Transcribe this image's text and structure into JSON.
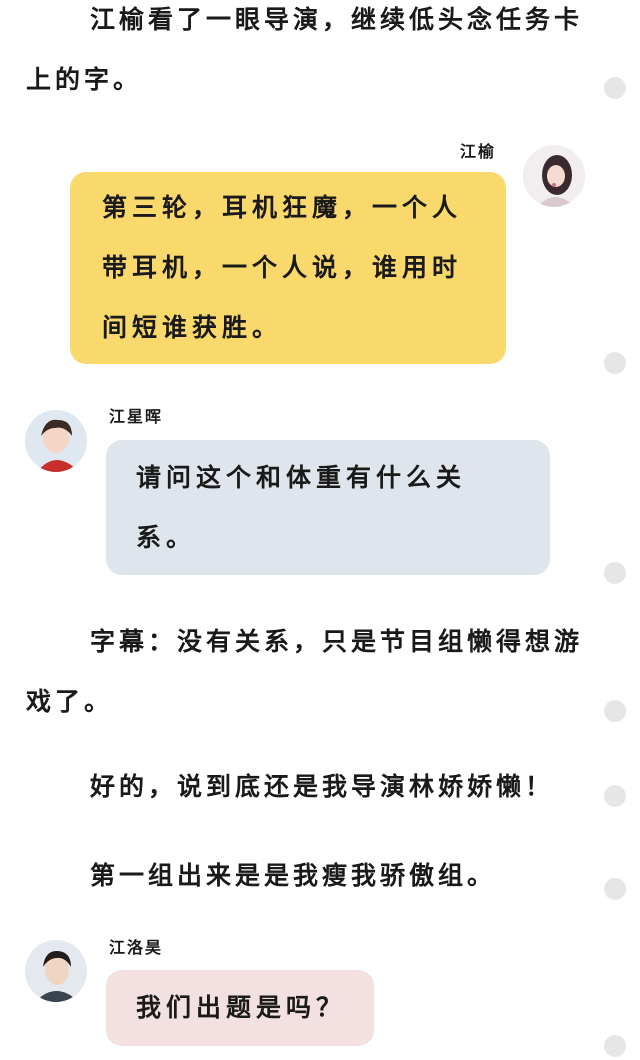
{
  "colors": {
    "bubble_yellow": "#FAD96C",
    "bubble_blue": "#DFE5EC",
    "bubble_pink": "#F3E0E0",
    "marker_gray": "#E6E6E6",
    "text": "#1A1A1A"
  },
  "paragraphs": [
    "江榆看了一眼导演，继续低头念任务卡上的字。",
    "字幕：没有关系，只是节目组懒得想游戏了。",
    "好的，说到底还是我导演林娇娇懒！",
    "第一组出来是是我瘦我骄傲组。"
  ],
  "messages": [
    {
      "sender": "江榆",
      "side": "right",
      "avatar_icon": "girl-portrait-icon",
      "lines": [
        "第三轮，耳机狂魔，一个人",
        "带耳机，一个人说，谁用时",
        "间短谁获胜。"
      ]
    },
    {
      "sender": "江星晖",
      "side": "left",
      "avatar_icon": "boy-portrait-icon",
      "lines": [
        "请问这个和体重有什么关",
        "系。"
      ]
    },
    {
      "sender": "江洛昊",
      "side": "left",
      "avatar_icon": "boy-portrait-icon",
      "lines": [
        "我们出题是吗？"
      ]
    }
  ]
}
